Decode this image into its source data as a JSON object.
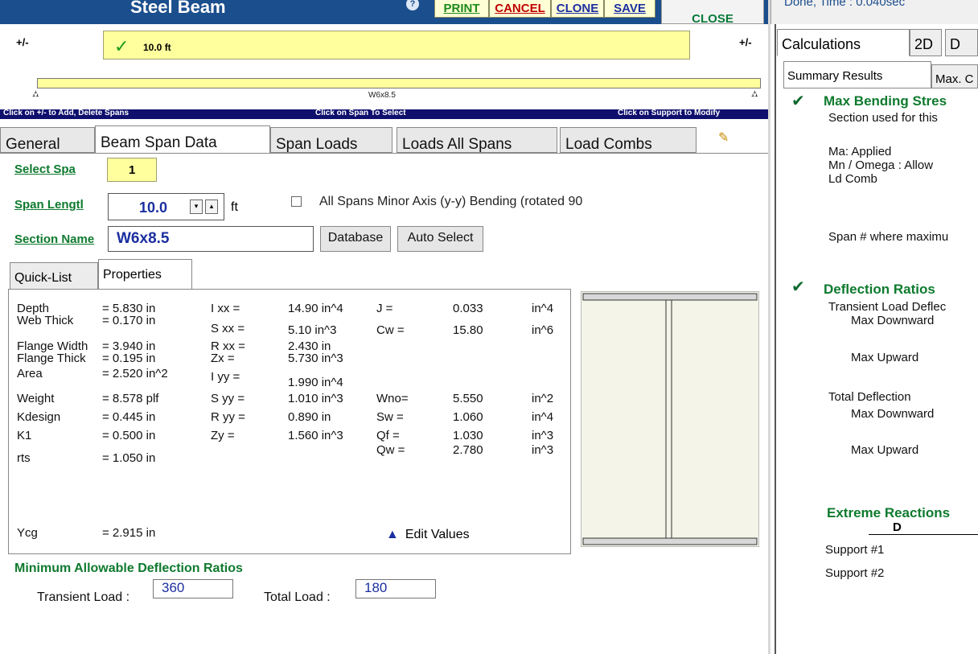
{
  "window": {
    "title": "Steel Beam",
    "help_symbol": "?",
    "buttons": {
      "print": "PRINT",
      "cancel": "CANCEL",
      "clone": "CLONE",
      "save": "SAVE",
      "close": "CLOSE"
    },
    "status": "Done, Time :    0.040sec"
  },
  "span_strip": {
    "add_delete_left": "+/-",
    "add_delete_right": "+/-",
    "span_length": "10.0 ft",
    "beam_section": "W6x8.5",
    "hints": {
      "left": "Click on  +/-  to Add, Delete Spans",
      "center": "Click on Span To Select",
      "right": "Click on Support to Modify"
    }
  },
  "tabs": [
    "General",
    "Beam Span Data",
    "Span Loads",
    "Loads All Spans",
    "Load Combs"
  ],
  "form": {
    "select_span_label": "Select Spa",
    "select_span_value": "1",
    "span_length_label": "Span Lengtl",
    "span_length_value": "10.0",
    "span_length_unit": "ft",
    "minor_axis_text": "All Spans Minor Axis (y-y) Bending   (rotated 90",
    "section_name_label": "Section Name",
    "section_name_value": "W6x8.5",
    "database_button": "Database",
    "auto_select_button": "Auto Select"
  },
  "subtabs": [
    "Quick-List",
    "Properties"
  ],
  "properties": {
    "col1": [
      {
        "name": "Depth",
        "value": "=  5.830 in"
      },
      {
        "name": "Web Thick",
        "value": "=  0.170 in"
      },
      {
        "name": "Flange Width",
        "value": "=  3.940 in"
      },
      {
        "name": "Flange Thick",
        "value": "=  0.195 in"
      },
      {
        "name": "Area",
        "value": "=  2.520 in^2"
      },
      {
        "name": "Weight",
        "value": "=  8.578 plf"
      },
      {
        "name": "Kdesign",
        "value": "=  0.445 in"
      },
      {
        "name": "K1",
        "value": "=  0.500 in"
      },
      {
        "name": "rts",
        "value": "=  1.050 in"
      },
      {
        "name": "Ycg",
        "value": "=  2.915 in"
      }
    ],
    "col2": [
      {
        "name": "I xx  =",
        "value": "14.90  in^4"
      },
      {
        "name": "S xx  =",
        "value": "5.10  in^3"
      },
      {
        "name": "R xx  =",
        "value": "2.430  in"
      },
      {
        "name": "Zx    =",
        "value": "5.730  in^3"
      },
      {
        "name": "I yy   =",
        "value": "1.990  in^4"
      },
      {
        "name": "S yy  =",
        "value": "1.010  in^3"
      },
      {
        "name": "R yy  =",
        "value": "0.890  in"
      },
      {
        "name": "Zy    =",
        "value": "1.560  in^3"
      }
    ],
    "col3": [
      {
        "name": "J      =",
        "value": "0.033",
        "unit": "in^4"
      },
      {
        "name": "Cw   =",
        "value": "15.80",
        "unit": "in^6"
      },
      {
        "name": "Wno=",
        "value": "5.550",
        "unit": "in^2"
      },
      {
        "name": "Sw   =",
        "value": "1.060",
        "unit": "in^4"
      },
      {
        "name": "Qf    =",
        "value": "1.030",
        "unit": "in^3"
      },
      {
        "name": "Qw   =",
        "value": "2.780",
        "unit": "in^3"
      }
    ],
    "edit_values_label": "Edit Values"
  },
  "deflection_limits": {
    "title": "Minimum Allowable Deflection Ratios",
    "transient_label": "Transient Load :",
    "transient_value": "360",
    "total_label": "Total Load :",
    "total_value": "180"
  },
  "right_panel": {
    "tabs": [
      "Calculations",
      "2D",
      "D"
    ],
    "subtabs": [
      "Summary Results",
      "Max. C"
    ],
    "bending": {
      "title": "Max Bending Stres",
      "section_used": "Section used for this",
      "applied": "Ma: Applied",
      "allow": "Mn / Omega : Allow",
      "ld_comb": "Ld Comb",
      "span_where": "Span # where maximu"
    },
    "deflection": {
      "title": "Deflection Ratios",
      "transient": "Transient Load Deflec",
      "max_down_1": "Max Downward",
      "max_up_1": "Max Upward",
      "total": "Total Deflection",
      "max_down_2": "Max Downward",
      "max_up_2": "Max Upward"
    },
    "reactions": {
      "title": "Extreme Reactions",
      "col_d": "D",
      "support1": "Support #1",
      "support2": "Support #2"
    }
  },
  "colors": {
    "title_bar": "#1b4e8c",
    "accent_green": "#0e7a2e",
    "input_yellow": "#ffff9e",
    "value_blue": "#1b2fa0"
  }
}
